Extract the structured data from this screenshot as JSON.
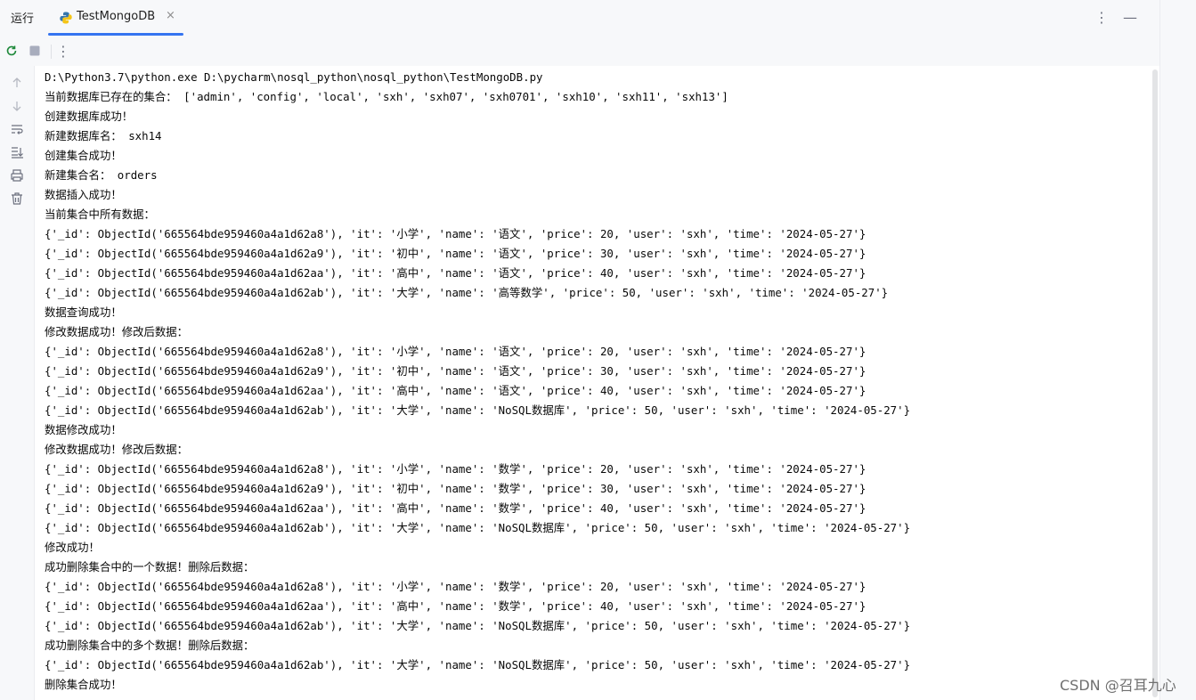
{
  "header": {
    "run_label": "运行",
    "tab_label": "TestMongoDB",
    "tab_close": "×",
    "more_icon": "⋮",
    "minimize_icon": "—"
  },
  "toolbar": {
    "more_icon": "⋮"
  },
  "console": {
    "lines": [
      "D:\\Python3.7\\python.exe D:\\pycharm\\nosql_python\\nosql_python\\TestMongoDB.py",
      "当前数据库已存在的集合： ['admin', 'config', 'local', 'sxh', 'sxh07', 'sxh0701', 'sxh10', 'sxh11', 'sxh13']",
      "创建数据库成功！",
      "新建数据库名： sxh14",
      "创建集合成功！",
      "新建集合名： orders",
      "数据插入成功！",
      "当前集合中所有数据：",
      "{'_id': ObjectId('665564bde959460a4a1d62a8'), 'it': '小学', 'name': '语文', 'price': 20, 'user': 'sxh', 'time': '2024-05-27'}",
      "{'_id': ObjectId('665564bde959460a4a1d62a9'), 'it': '初中', 'name': '语文', 'price': 30, 'user': 'sxh', 'time': '2024-05-27'}",
      "{'_id': ObjectId('665564bde959460a4a1d62aa'), 'it': '高中', 'name': '语文', 'price': 40, 'user': 'sxh', 'time': '2024-05-27'}",
      "{'_id': ObjectId('665564bde959460a4a1d62ab'), 'it': '大学', 'name': '高等数学', 'price': 50, 'user': 'sxh', 'time': '2024-05-27'}",
      "数据查询成功！",
      "修改数据成功！修改后数据：",
      "{'_id': ObjectId('665564bde959460a4a1d62a8'), 'it': '小学', 'name': '语文', 'price': 20, 'user': 'sxh', 'time': '2024-05-27'}",
      "{'_id': ObjectId('665564bde959460a4a1d62a9'), 'it': '初中', 'name': '语文', 'price': 30, 'user': 'sxh', 'time': '2024-05-27'}",
      "{'_id': ObjectId('665564bde959460a4a1d62aa'), 'it': '高中', 'name': '语文', 'price': 40, 'user': 'sxh', 'time': '2024-05-27'}",
      "{'_id': ObjectId('665564bde959460a4a1d62ab'), 'it': '大学', 'name': 'NoSQL数据库', 'price': 50, 'user': 'sxh', 'time': '2024-05-27'}",
      "数据修改成功！",
      "修改数据成功！修改后数据：",
      "{'_id': ObjectId('665564bde959460a4a1d62a8'), 'it': '小学', 'name': '数学', 'price': 20, 'user': 'sxh', 'time': '2024-05-27'}",
      "{'_id': ObjectId('665564bde959460a4a1d62a9'), 'it': '初中', 'name': '数学', 'price': 30, 'user': 'sxh', 'time': '2024-05-27'}",
      "{'_id': ObjectId('665564bde959460a4a1d62aa'), 'it': '高中', 'name': '数学', 'price': 40, 'user': 'sxh', 'time': '2024-05-27'}",
      "{'_id': ObjectId('665564bde959460a4a1d62ab'), 'it': '大学', 'name': 'NoSQL数据库', 'price': 50, 'user': 'sxh', 'time': '2024-05-27'}",
      "修改成功！",
      "成功删除集合中的一个数据！删除后数据：",
      "{'_id': ObjectId('665564bde959460a4a1d62a8'), 'it': '小学', 'name': '数学', 'price': 20, 'user': 'sxh', 'time': '2024-05-27'}",
      "{'_id': ObjectId('665564bde959460a4a1d62aa'), 'it': '高中', 'name': '数学', 'price': 40, 'user': 'sxh', 'time': '2024-05-27'}",
      "{'_id': ObjectId('665564bde959460a4a1d62ab'), 'it': '大学', 'name': 'NoSQL数据库', 'price': 50, 'user': 'sxh', 'time': '2024-05-27'}",
      "成功删除集合中的多个数据！删除后数据：",
      "{'_id': ObjectId('665564bde959460a4a1d62ab'), 'it': '大学', 'name': 'NoSQL数据库', 'price': 50, 'user': 'sxh', 'time': '2024-05-27'}",
      "删除集合成功！"
    ]
  },
  "watermark": "CSDN @召耳九心",
  "colors": {
    "accent": "#3574f0",
    "panel_bg": "#f7f8fa",
    "text": "#080808",
    "icon": "#6c707e"
  }
}
